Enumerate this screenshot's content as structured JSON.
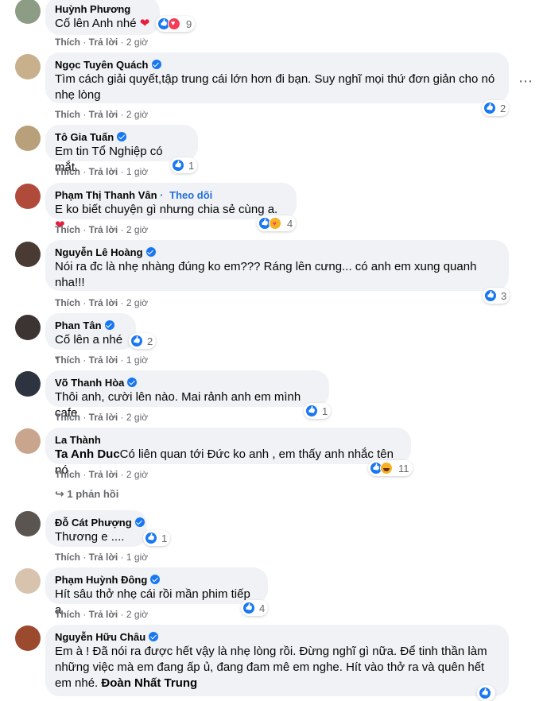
{
  "actions": {
    "like": "Thích",
    "reply": "Trả lời",
    "sep": " · "
  },
  "more_icon": "⋯",
  "comments": [
    {
      "name": "Huỳnh Phương",
      "text": "Cố lên Anh nhé ",
      "emoji": "❤",
      "time": "2 giờ",
      "count": "9",
      "reacts": [
        "like",
        "love"
      ],
      "verified": false,
      "avatar": "#8d9c84"
    },
    {
      "name": "Ngọc Tuyên Quách",
      "text": "Tìm cách giải quyết,tập trung cái lớn hơn đi bạn. Suy nghĩ mọi thứ đơn giản cho nó nhẹ lòng",
      "time": "2 giờ",
      "count": "2",
      "reacts": [
        "like"
      ],
      "verified": true,
      "avatar": "#c9b08c"
    },
    {
      "name": "Tô Gia Tuấn",
      "text": "Em tin Tổ Nghiệp có mắt.",
      "time": "1 giờ",
      "count": "1",
      "reacts": [
        "like"
      ],
      "verified": true,
      "avatar": "#b7a07a"
    },
    {
      "name": "Phạm Thị Thanh Vân",
      "follow": "Theo dõi",
      "text": "E ko biết chuyện gì nhưng chia sẻ cùng a.",
      "emoji": "❤",
      "time": "2 giờ",
      "count": "4",
      "reacts": [
        "like",
        "care"
      ],
      "verified": false,
      "avatar": "#b04b3c"
    },
    {
      "name": "Nguyễn Lê Hoàng",
      "text": "Nói ra đc là nhẹ nhàng đúng ko em??? Ráng lên cưng... có anh em xung quanh nha!!!",
      "time": "2 giờ",
      "count": "3",
      "reacts": [
        "like"
      ],
      "verified": true,
      "avatar": "#4a3a34"
    },
    {
      "name": "Phan Tân",
      "text": "Cố lên a nhé .",
      "time": "1 giờ",
      "count": "2",
      "reacts": [
        "like"
      ],
      "verified": true,
      "avatar": "#3b3433"
    },
    {
      "name": "Võ Thanh Hòa",
      "text": "Thôi anh, cười lên nào. Mai rảnh anh em mình cafe",
      "time": "2 giờ",
      "count": "1",
      "reacts": [
        "like"
      ],
      "verified": true,
      "avatar": "#2e3340"
    },
    {
      "name": "La Thành",
      "mention": "Ta Anh Duc",
      "text": "Có liên quan tới Đức ko anh , em thấy anh nhắc tên nó",
      "time": "2 giờ",
      "count": "11",
      "reacts": [
        "like",
        "haha"
      ],
      "verified": false,
      "avatar": "#caa58e",
      "replies": "1 phản hồi"
    },
    {
      "name": "Đỗ Cát Phượng",
      "text": "Thương e ....",
      "time": "1 giờ",
      "count": "1",
      "reacts": [
        "like"
      ],
      "verified": true,
      "avatar": "#5b5551"
    },
    {
      "name": "Phạm Huỳnh Đông",
      "text": "Hít sâu thở nhẹ cái rồi mần phim tiếp a",
      "time": "2 giờ",
      "count": "4",
      "reacts": [
        "like"
      ],
      "verified": true,
      "avatar": "#d8c4ae"
    },
    {
      "name": "Nguyễn Hữu Châu",
      "text": "Em à ! Đã nói ra được hết vậy là nhẹ lòng rồi. Đừng nghĩ gì nữa. Để tinh thần làm những việc mà em đang ấp ủ, đang đam mê em nghe. Hít vào thở ra và quên hết em nhé. ",
      "tail_mention": "Đoàn Nhất Trung",
      "time": "",
      "count": "",
      "reacts": [
        "like"
      ],
      "verified": true,
      "avatar": "#9b4a2e"
    }
  ]
}
